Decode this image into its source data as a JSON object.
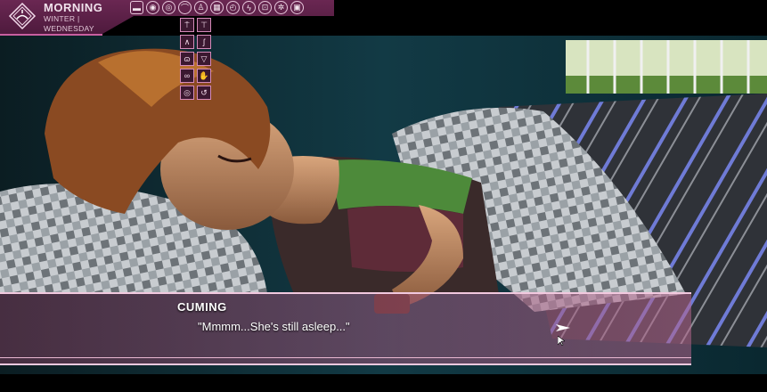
{
  "hud": {
    "time_of_day": "MORNING",
    "season": "WINTER |",
    "weekday": "WEDNESDAY"
  },
  "top_icons": [
    "bed-icon",
    "eye-icon",
    "eye-outline-icon",
    "hanger-icon",
    "person-icon",
    "map-icon",
    "clock-icon",
    "lightning-icon",
    "car-icon",
    "gear-icon",
    "save-icon"
  ],
  "dress_buttons": [
    "shirt-icon",
    "top-icon",
    "pants-icon",
    "sock-icon",
    "bra-icon",
    "panties-icon",
    "bikini-icon",
    "hand-icon",
    "swap-icon",
    "undo-icon"
  ],
  "dialogue": {
    "speaker": "CUMING",
    "text": "\"Mmmm...She's still asleep...\""
  },
  "colors": {
    "panel": "#5a1f47",
    "accent": "#c85fa0",
    "dialogue_border": "#f2c9df"
  }
}
